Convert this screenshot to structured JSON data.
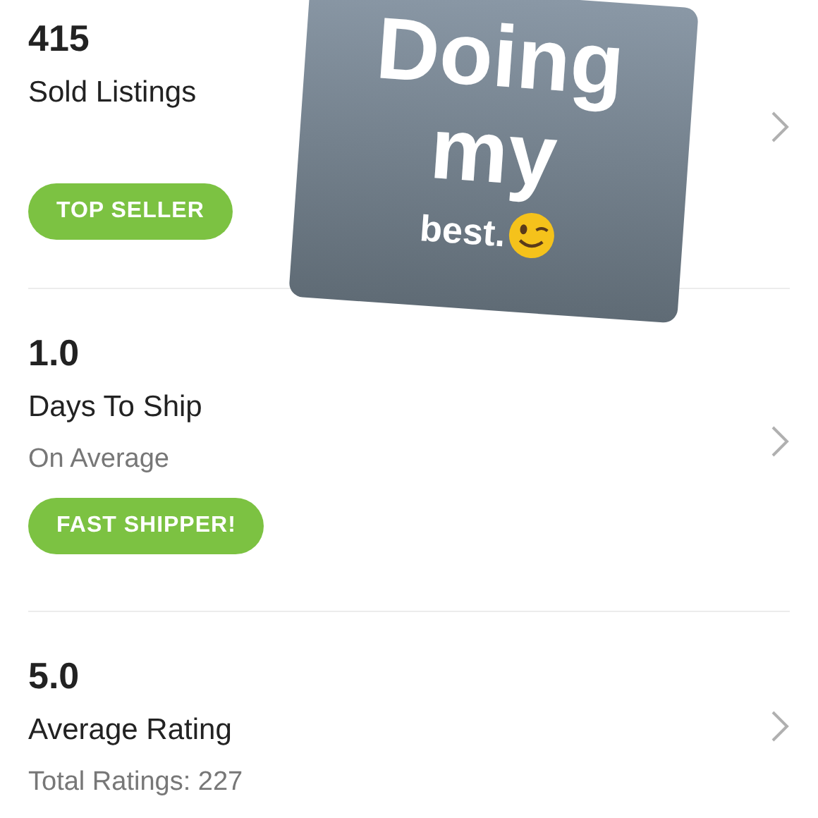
{
  "stats": [
    {
      "value": "415",
      "label": "Sold Listings",
      "badge": "TOP SELLER"
    },
    {
      "value": "1.0",
      "label": "Days To Ship",
      "subtitle": "On Average",
      "badge": "FAST SHIPPER!"
    },
    {
      "value": "5.0",
      "label": "Average Rating",
      "subtitle": "Total Ratings: 227"
    }
  ],
  "sticker": {
    "lines": [
      "Doing",
      "my",
      "best."
    ]
  }
}
